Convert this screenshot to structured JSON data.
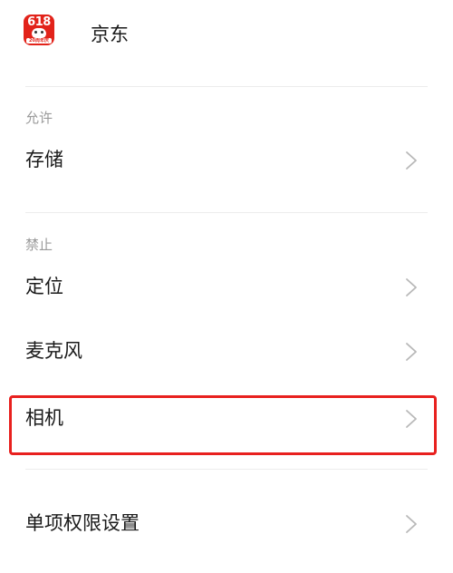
{
  "app": {
    "name": "京东",
    "icon_name": "jd-618-app-icon",
    "icon_badge": "618",
    "icon_strip": "20周年庆",
    "icon_color": "#e2231a"
  },
  "sections": {
    "allowed": {
      "label": "允许",
      "items": [
        {
          "label": "存储"
        }
      ]
    },
    "denied": {
      "label": "禁止",
      "items": [
        {
          "label": "定位"
        },
        {
          "label": "麦克风"
        },
        {
          "label": "相机"
        }
      ]
    }
  },
  "single_permission": {
    "label": "单项权限设置"
  },
  "highlight": {
    "target": "相机",
    "color": "#e8201e"
  },
  "chevron_icon": "chevron-right-icon"
}
